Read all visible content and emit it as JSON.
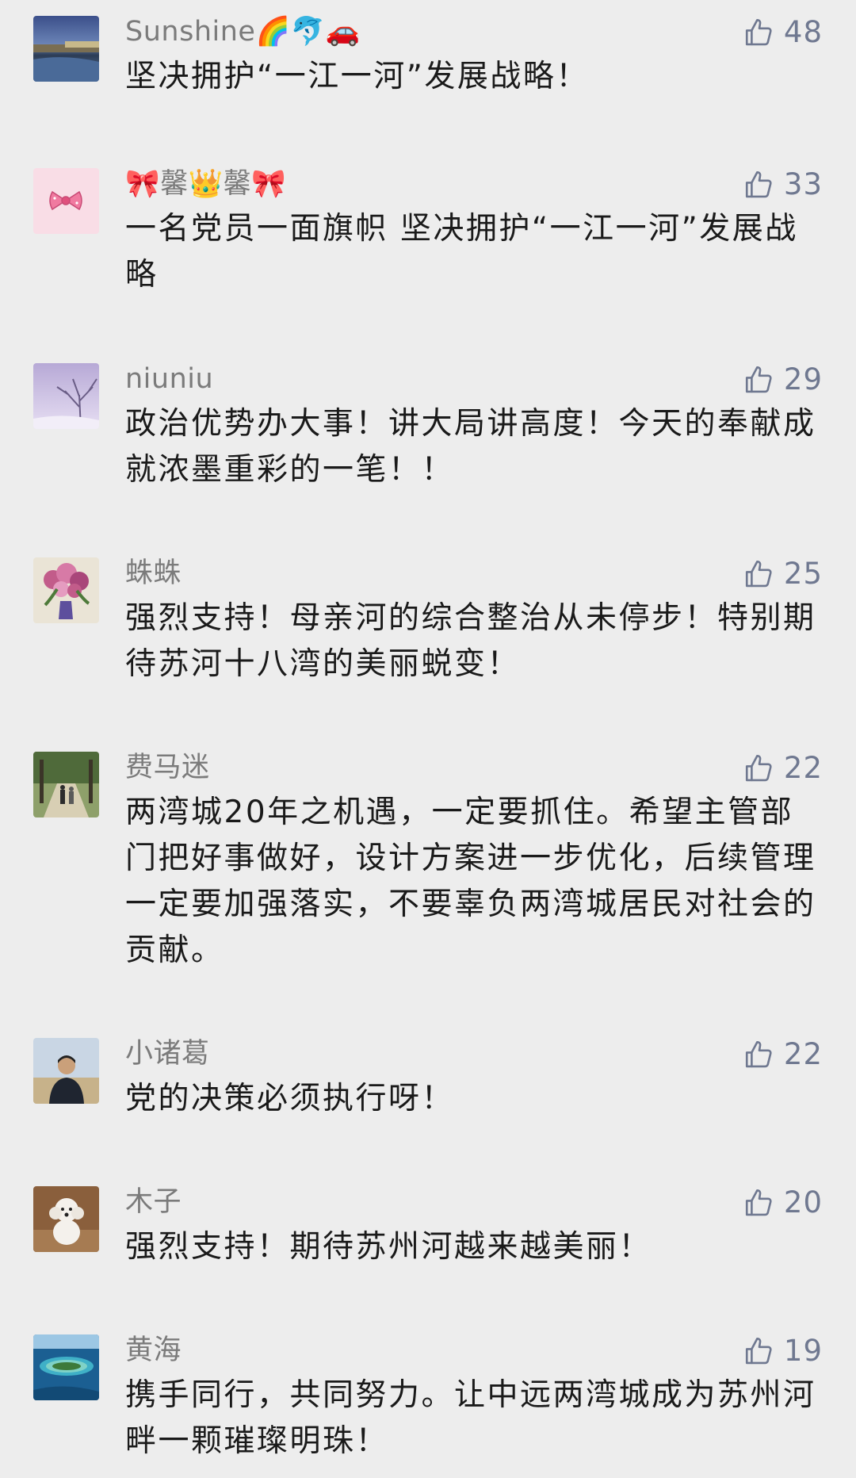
{
  "comments": [
    {
      "name": "Sunshine🌈🐬🚗",
      "likes": "48",
      "text": "坚决拥护“一江一河”发展战略！",
      "avatar_icon": "river-landscape-avatar"
    },
    {
      "name": "🎀馨👑馨🎀",
      "likes": "33",
      "text": "一名党员一面旗帜 坚决拥护“一江一河”发展战略",
      "avatar_icon": "pink-bow-avatar"
    },
    {
      "name": "niuniu",
      "likes": "29",
      "text": "政治优势办大事！讲大局讲高度！今天的奉献成就浓墨重彩的一笔！！",
      "avatar_icon": "frosted-tree-avatar"
    },
    {
      "name": "蛛蛛",
      "likes": "25",
      "text": "强烈支持！母亲河的综合整治从未停步！特别期待苏河十八湾的美丽蜕变！",
      "avatar_icon": "flower-vase-avatar"
    },
    {
      "name": "费马迷",
      "likes": "22",
      "text": "两湾城20年之机遇，一定要抓住。希望主管部门把好事做好，设计方案进一步优化，后续管理一定要加强落实，不要辜负两湾城居民对社会的贡献。",
      "avatar_icon": "tree-lined-path-avatar"
    },
    {
      "name": "小诸葛",
      "likes": "22",
      "text": "党的决策必须执行呀！",
      "avatar_icon": "person-portrait-avatar"
    },
    {
      "name": "木子",
      "likes": "20",
      "text": "强烈支持！期待苏州河越来越美丽！",
      "avatar_icon": "white-dog-avatar"
    },
    {
      "name": "黄海",
      "likes": "19",
      "text": "携手同行，共同努力。让中远两湾城成为苏州河畔一颗璀璨明珠！",
      "avatar_icon": "island-aerial-avatar"
    }
  ],
  "colors": {
    "background": "#ededed",
    "name": "#7b7b7b",
    "text": "#1a1a1a",
    "like": "#6f7890"
  }
}
